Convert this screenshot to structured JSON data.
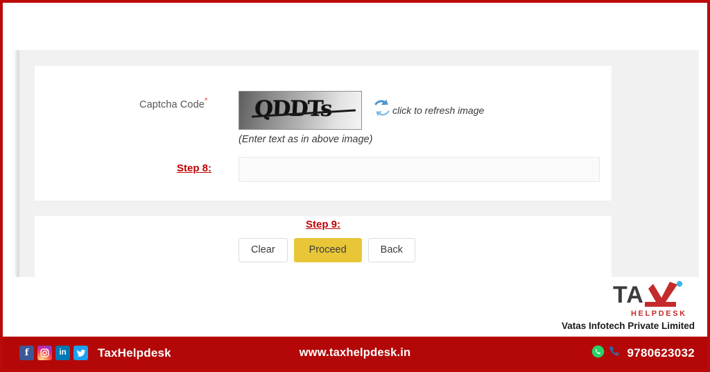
{
  "form": {
    "captcha_label": "Captcha Code",
    "required_marker": "*",
    "captcha_code": "QDDTs",
    "refresh_icon": "refresh-icon",
    "refresh_text": "click to refresh image",
    "hint_text": "(Enter text as in above image)",
    "step8_label": "Step 8:",
    "captcha_input_value": "",
    "captcha_input_placeholder": ""
  },
  "actions": {
    "step9_label": "Step 9:",
    "clear_label": "Clear",
    "proceed_label": "Proceed",
    "back_label": "Back"
  },
  "branding": {
    "logo_text": "TAX",
    "logo_subtext": "HELPDESK",
    "company_name": "Vatas Infotech Private Limited"
  },
  "footer": {
    "social": [
      {
        "name": "facebook-icon",
        "glyph": "f"
      },
      {
        "name": "instagram-icon",
        "glyph": ""
      },
      {
        "name": "linkedin-icon",
        "glyph": "in"
      },
      {
        "name": "twitter-icon",
        "glyph": ""
      }
    ],
    "brand": "TaxHelpdesk",
    "website": "www.taxhelpdesk.in",
    "whatsapp_icon": "whatsapp-icon",
    "phone_icon": "phone-icon",
    "phone": "9780623032"
  },
  "colors": {
    "frame_red": "#bb0a0a",
    "footer_red": "#b40808",
    "step_red": "#c00000",
    "proceed_yellow": "#e8c637",
    "page_grey": "#f1f1f1"
  }
}
